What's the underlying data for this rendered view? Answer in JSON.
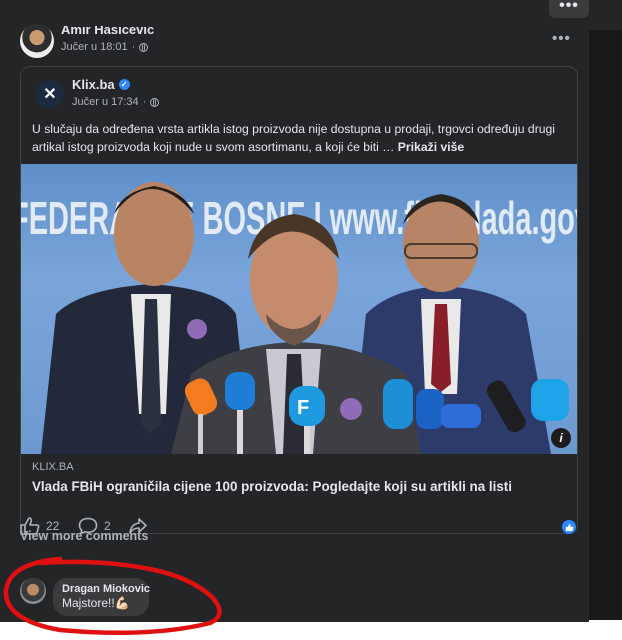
{
  "top_bar": {
    "more_label": "•••"
  },
  "post": {
    "author": "Amir Hasicevic",
    "time": "Jučer u 18:01",
    "more_label": "•••"
  },
  "shared": {
    "source": "Klix.ba",
    "time": "Jučer u 17:34",
    "text": "U slučaju da određena vrsta artikla istog proizvoda nije dostupna u prodaji, trgovci određuju drugi artikal istog proizvoda koji nude u svom asortimanu, a koji će biti …",
    "see_more": "Prikaži više",
    "photo_text": "FEDERACIJE BOSNE I www.fbihvlada.gov",
    "link_domain": "KLIX.BA",
    "link_title": "Vlada FBiH ograničila cijene 100 proizvoda: Pogledajte koji su artikli na listi"
  },
  "reactions": {
    "likes": "22",
    "comments": "2"
  },
  "comments": {
    "view_more": "View more comments",
    "items": [
      {
        "author": "Dragan Miokovic",
        "text": "Majstore!!💪🏻"
      }
    ]
  },
  "colors": {
    "post_bg": "#242526",
    "bubble_bg": "#3a3b3c",
    "accent_blue": "#2d88ff",
    "annotation_red": "#e01010"
  }
}
